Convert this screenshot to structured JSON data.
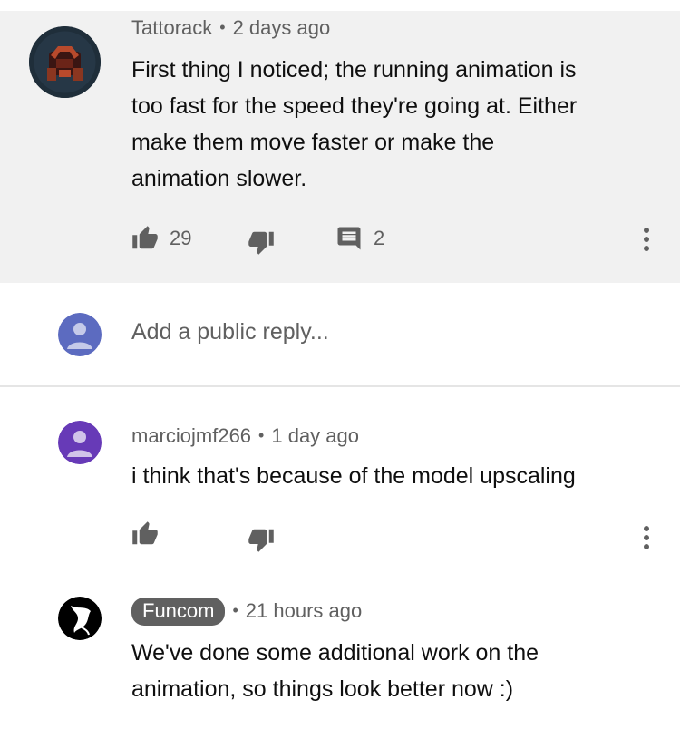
{
  "comment": {
    "author": "Tattorack",
    "time": "2 days ago",
    "text_lines": [
      "First thing I noticed; the running animation is",
      "too fast for the speed they're going at. Either",
      "make them move faster or make the",
      "animation slower."
    ],
    "likes": "29",
    "replies": "2"
  },
  "reply_box": {
    "placeholder": "Add a public reply..."
  },
  "replies": [
    {
      "author": "marciojmf266",
      "time": "1 day ago",
      "text": "i think that's because of the model upscaling"
    },
    {
      "author": "Funcom",
      "time": "21 hours ago",
      "text_lines": [
        "We've done some additional work on the",
        "animation, so things look better now :)"
      ]
    }
  ],
  "colors": {
    "main_bg": "#f1f1f1",
    "meta_gray": "#606060",
    "user_avatar": "#5c6bc0",
    "reply_avatar": "#673ab7",
    "funcom_avatar": "#000000"
  }
}
